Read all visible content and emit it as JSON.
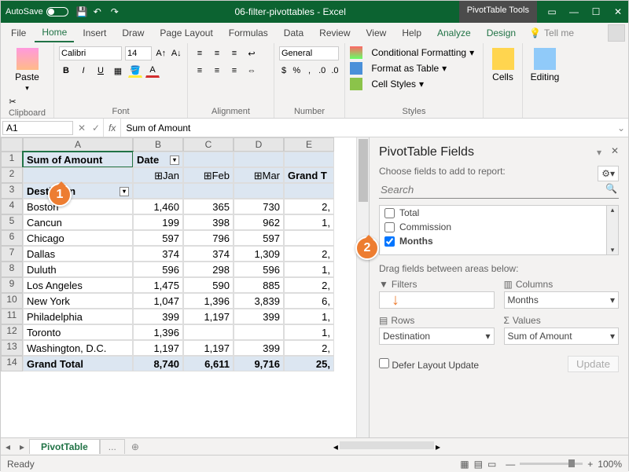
{
  "titlebar": {
    "autosave": "AutoSave",
    "filename": "06-filter-pivottables - Excel",
    "contextual": "PivotTable Tools"
  },
  "menu": {
    "file": "File",
    "home": "Home",
    "insert": "Insert",
    "draw": "Draw",
    "pagelayout": "Page Layout",
    "formulas": "Formulas",
    "data": "Data",
    "review": "Review",
    "view": "View",
    "help": "Help",
    "analyze": "Analyze",
    "design": "Design",
    "tellme": "Tell me"
  },
  "ribbon": {
    "paste": "Paste",
    "clipboard": "Clipboard",
    "font_name": "Calibri",
    "font_size": "14",
    "font": "Font",
    "alignment": "Alignment",
    "number_format": "General",
    "number": "Number",
    "cond_fmt": "Conditional Formatting",
    "fmt_table": "Format as Table",
    "cell_styles": "Cell Styles",
    "styles": "Styles",
    "cells": "Cells",
    "editing": "Editing"
  },
  "formula": {
    "cellref": "A1",
    "fx": "fx",
    "value": "Sum of Amount"
  },
  "cols": [
    "A",
    "B",
    "C",
    "D",
    "E"
  ],
  "pivot": {
    "corner": "Sum of Amount",
    "colfield": "Date",
    "rowfield": "Destin",
    "months": [
      "Jan",
      "Feb",
      "Mar"
    ],
    "grandcol": "Grand T",
    "rows": [
      {
        "label": "Boston",
        "v": [
          "1,460",
          "365",
          "730",
          "2,"
        ]
      },
      {
        "label": "Cancun",
        "v": [
          "199",
          "398",
          "962",
          "1,"
        ]
      },
      {
        "label": "Chicago",
        "v": [
          "597",
          "796",
          "597",
          ""
        ]
      },
      {
        "label": "Dallas",
        "v": [
          "374",
          "374",
          "1,309",
          "2,"
        ]
      },
      {
        "label": "Duluth",
        "v": [
          "596",
          "298",
          "596",
          "1,"
        ]
      },
      {
        "label": "Los Angeles",
        "v": [
          "1,475",
          "590",
          "885",
          "2,"
        ]
      },
      {
        "label": "New York",
        "v": [
          "1,047",
          "1,396",
          "3,839",
          "6,"
        ]
      },
      {
        "label": "Philadelphia",
        "v": [
          "399",
          "1,197",
          "399",
          "1,"
        ]
      },
      {
        "label": "Toronto",
        "v": [
          "1,396",
          "",
          "",
          "1,"
        ]
      },
      {
        "label": "Washington, D.C.",
        "v": [
          "1,197",
          "1,197",
          "399",
          "2,"
        ]
      }
    ],
    "total_label": "Grand Total",
    "totals": [
      "8,740",
      "6,611",
      "9,716",
      "25,"
    ]
  },
  "pane": {
    "title": "PivotTable Fields",
    "sub": "Choose fields to add to report:",
    "search": "Search",
    "fields": [
      {
        "label": "Total",
        "checked": false
      },
      {
        "label": "Commission",
        "checked": false
      },
      {
        "label": "Months",
        "checked": true
      }
    ],
    "drag": "Drag fields between areas below:",
    "filters": "Filters",
    "columns": "Columns",
    "rows": "Rows",
    "values": "Values",
    "col_val": "Months",
    "row_val": "Destination",
    "val_val": "Sum of Amount",
    "defer": "Defer Layout Update",
    "update": "Update",
    "sigma": "Σ"
  },
  "tabs": {
    "sheet": "PivotTable",
    "more": "..."
  },
  "status": {
    "ready": "Ready",
    "zoom": "100%"
  },
  "callouts": {
    "c1": "1",
    "c2": "2"
  }
}
